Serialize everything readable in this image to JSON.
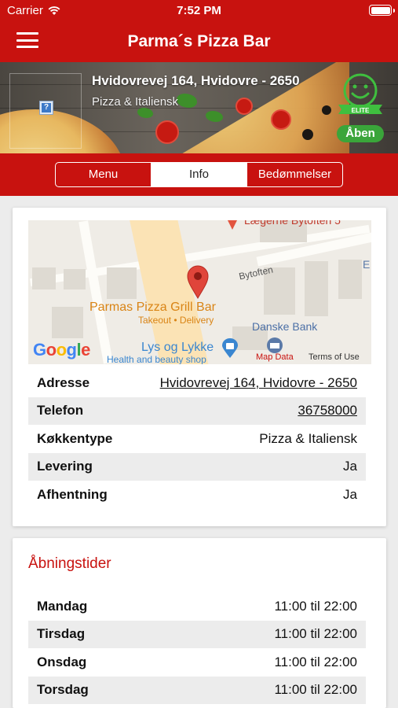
{
  "status_bar": {
    "carrier": "Carrier",
    "time": "7:52 PM"
  },
  "nav": {
    "title": "Parma´s Pizza Bar"
  },
  "hero": {
    "address": "Hvidovrevej 164, Hvidovre - 2650",
    "cuisine": "Pizza & Italiensk",
    "badge_text": "ELITE",
    "open_status": "Åben",
    "logo_placeholder": "?"
  },
  "tabs": [
    {
      "label": "Menu",
      "active": false
    },
    {
      "label": "Info",
      "active": true
    },
    {
      "label": "Bedømmelser",
      "active": false
    }
  ],
  "map": {
    "place_name": "Parmas Pizza Grill Bar",
    "place_sub": "Takeout • Delivery",
    "street": "Bytoften",
    "bank": "Danske Bank",
    "shop": "Lys og Lykke",
    "shop_sub": "Health and beauty shop",
    "top_label": "Lægerne Bytoften 5",
    "corner_letter": "E",
    "brand": "Google",
    "map_data": "Map Data",
    "terms": "Terms of Use"
  },
  "info_rows": [
    {
      "key": "Adresse",
      "value": "Hvidovrevej 164, Hvidovre - 2650",
      "link": true
    },
    {
      "key": "Telefon",
      "value": "36758000",
      "link": true
    },
    {
      "key": "Køkkentype",
      "value": "Pizza & Italiensk",
      "link": false
    },
    {
      "key": "Levering",
      "value": "Ja",
      "link": false
    },
    {
      "key": "Afhentning",
      "value": "Ja",
      "link": false
    }
  ],
  "opening_hours": {
    "title": "Åbningstider",
    "days": [
      {
        "day": "Mandag",
        "hours": "11:00 til 22:00"
      },
      {
        "day": "Tirsdag",
        "hours": "11:00 til 22:00"
      },
      {
        "day": "Onsdag",
        "hours": "11:00 til 22:00"
      },
      {
        "day": "Torsdag",
        "hours": "11:00 til 22:00"
      }
    ]
  },
  "colors": {
    "brand_red": "#c8120f",
    "open_green": "#3aa53a",
    "row_shade": "#ececec"
  }
}
